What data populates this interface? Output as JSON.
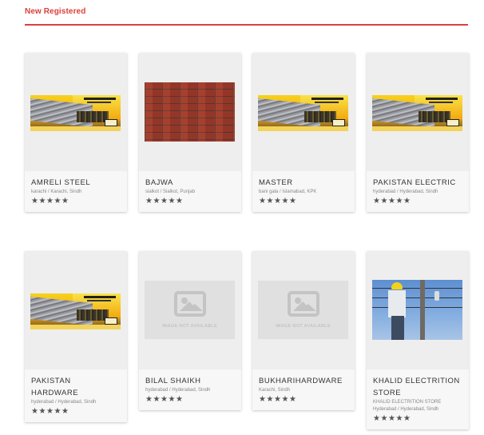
{
  "section": {
    "title": "New Registered",
    "accent_color": "#d9413b"
  },
  "rating_star": "★",
  "cards": [
    {
      "name": "AMRELI STEEL",
      "location": "karachi / Karachi, Sindh",
      "rating": 5,
      "image": "steel-banner"
    },
    {
      "name": "BAJWA",
      "location": "sialkot / Sialkot, Punjab",
      "rating": 5,
      "image": "brick-wall"
    },
    {
      "name": "MASTER",
      "location": "bani gala / Islamabad, KPK",
      "rating": 5,
      "image": "steel-banner"
    },
    {
      "name": "PAKISTAN ELECTRIC",
      "location": "hyderabad / Hyderabad, Sindh",
      "rating": 5,
      "image": "steel-banner"
    },
    {
      "name": "PAKISTAN HARDWARE",
      "location": "hyderabad / Hyderabad, Sindh",
      "rating": 5,
      "image": "steel-banner"
    },
    {
      "name": "BILAL SHAIKH",
      "location": "hyderabad / Hyderabad, Sindh",
      "rating": 5,
      "image": "not-available",
      "image_text": "IMAGE NOT AVAILABLE"
    },
    {
      "name": "BUKHARIHARDWARE",
      "location": "Karachi, Sindh",
      "rating": 5,
      "image": "not-available",
      "image_text": "IMAGE NOT AVAILABLE"
    },
    {
      "name": "KHALID ELECTRITION STORE",
      "subtitle": "KHALID ELECTRITION STORE",
      "location": "Hyderabad / Hyderabad, Sindh",
      "rating": 5,
      "image": "electrician-photo"
    }
  ]
}
